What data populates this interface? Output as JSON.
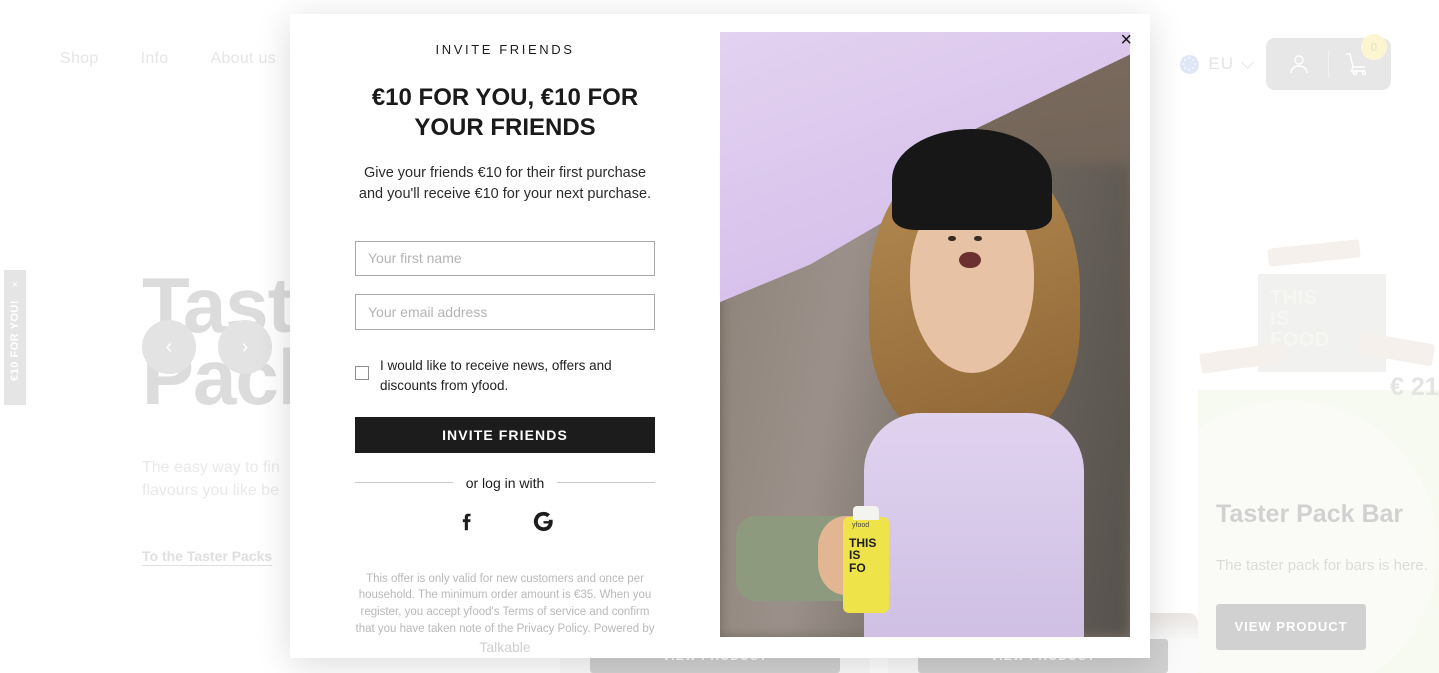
{
  "header": {
    "nav": [
      {
        "label": "Shop"
      },
      {
        "label": "Info"
      },
      {
        "label": "About us"
      }
    ],
    "region": {
      "label": "EU"
    },
    "cart": {
      "count": "0"
    }
  },
  "side_tab": {
    "close": "×",
    "label": "€10 FOR YOU!"
  },
  "hero": {
    "title_line1": "Tast",
    "title_line2": "Pack",
    "subtitle": "The easy way to fin\nflavours you like be",
    "link": "To the Taster Packs",
    "prev": "‹",
    "next": "›"
  },
  "right_card": {
    "title": "Taster Pack Bar",
    "description": "The taster pack for bars is here.",
    "button": "VIEW PRODUCT",
    "price": "€ 21,",
    "product_box_text": "THIS\nIS\nFOOD"
  },
  "bg_cards": [
    {
      "button": "VIEW PRODUCT"
    },
    {
      "button": "VIEW PRODUCT"
    }
  ],
  "modal": {
    "close": "×",
    "eyebrow": "INVITE FRIENDS",
    "title": "€10 FOR YOU, €10 FOR YOUR FRIENDS",
    "description": "Give your friends €10 for their first purchase and you'll receive €10 for your next purchase.",
    "first_name_placeholder": "Your first name",
    "first_name_value": "",
    "email_placeholder": "Your email address",
    "email_value": "",
    "consent_label": "I would like to receive news, offers and discounts from yfood.",
    "consent_checked": false,
    "submit_label": "INVITE FRIENDS",
    "or_label": "or log in with",
    "socials": [
      {
        "name": "facebook",
        "glyph": "f"
      },
      {
        "name": "google",
        "glyph": "G"
      }
    ],
    "fineprint": "This offer is only valid for new customers and once per household. The minimum order amount is €35. When you register, you accept yfood's Terms of service and confirm that you have taken note of the Privacy Policy. Powered by ",
    "powered_by": "Talkable",
    "photo": {
      "bottle_text": "THIS\nIS\nFO",
      "bottle_brand": "yfood"
    }
  },
  "colors": {
    "accent_dark": "#1c1c1c",
    "cart_badge": "#f5ec9a",
    "card_green": "#eef3e0",
    "muted": "#c6c6c6"
  }
}
